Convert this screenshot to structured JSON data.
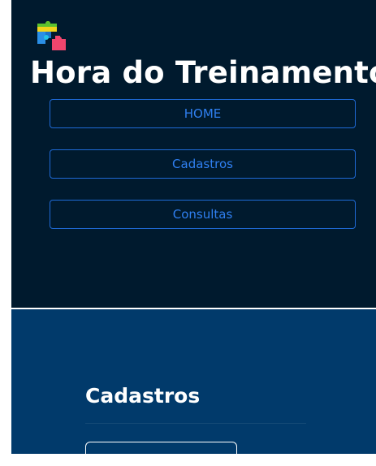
{
  "app": {
    "title": "Hora do Treinamento",
    "logo_icon": "puzzle-icon"
  },
  "nav": {
    "items": [
      {
        "label": "HOME"
      },
      {
        "label": "Cadastros"
      },
      {
        "label": "Consultas"
      }
    ]
  },
  "main": {
    "section_title": "Cadastros"
  },
  "colors": {
    "sidebar_bg": "#001a2e",
    "main_bg": "#013a6b",
    "nav_border": "#1f6ad6",
    "nav_text": "#2f7ff0"
  }
}
